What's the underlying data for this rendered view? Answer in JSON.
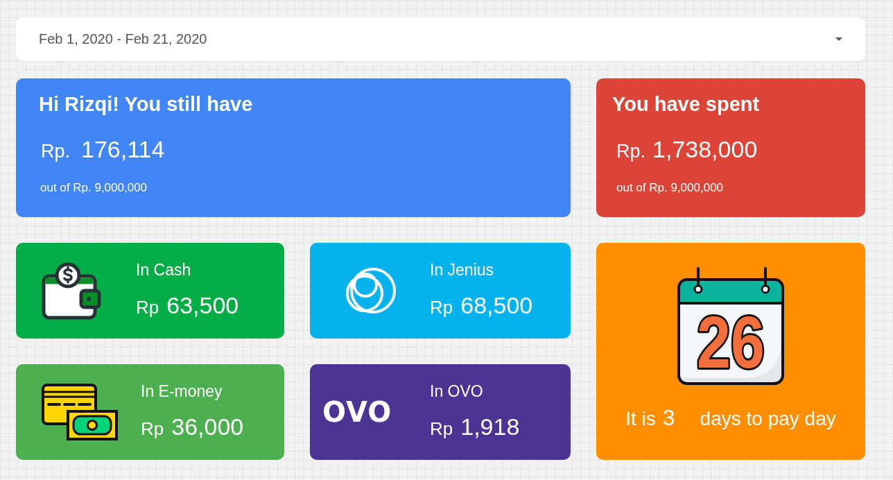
{
  "date_range": {
    "value": "Feb 1, 2020 - Feb 21, 2020"
  },
  "summary_cards": [
    {
      "kind": "remaining",
      "color": "#4285f4",
      "title": "Hi Rizqi! You still have",
      "currency": "Rp.",
      "amount": "176,114",
      "note": "out of Rp. 9,000,000"
    },
    {
      "kind": "spent",
      "color": "#db4437",
      "title": "You have spent",
      "currency": "Rp.",
      "amount": "1,738,000",
      "note": "out of Rp. 9,000,000"
    }
  ],
  "balances": [
    {
      "kind": "cash",
      "color": "#03ac44",
      "label": "In Cash",
      "currency": "Rp",
      "amount": "63,500"
    },
    {
      "kind": "jenius",
      "color": "#05b2ed",
      "label": "In Jenius",
      "currency": "Rp",
      "amount": "68,500"
    },
    {
      "kind": "emoney",
      "color": "#4caf50",
      "label": "In E-money",
      "currency": "Rp",
      "amount": "36,000"
    },
    {
      "kind": "ovo",
      "color": "#4c3494",
      "label": "In OVO",
      "currency": "Rp",
      "amount": "1,918",
      "logo_text": "OVO"
    }
  ],
  "payday": {
    "calendar_day": "26",
    "prefix": "It is",
    "days": "3",
    "suffix": "days to pay day"
  }
}
